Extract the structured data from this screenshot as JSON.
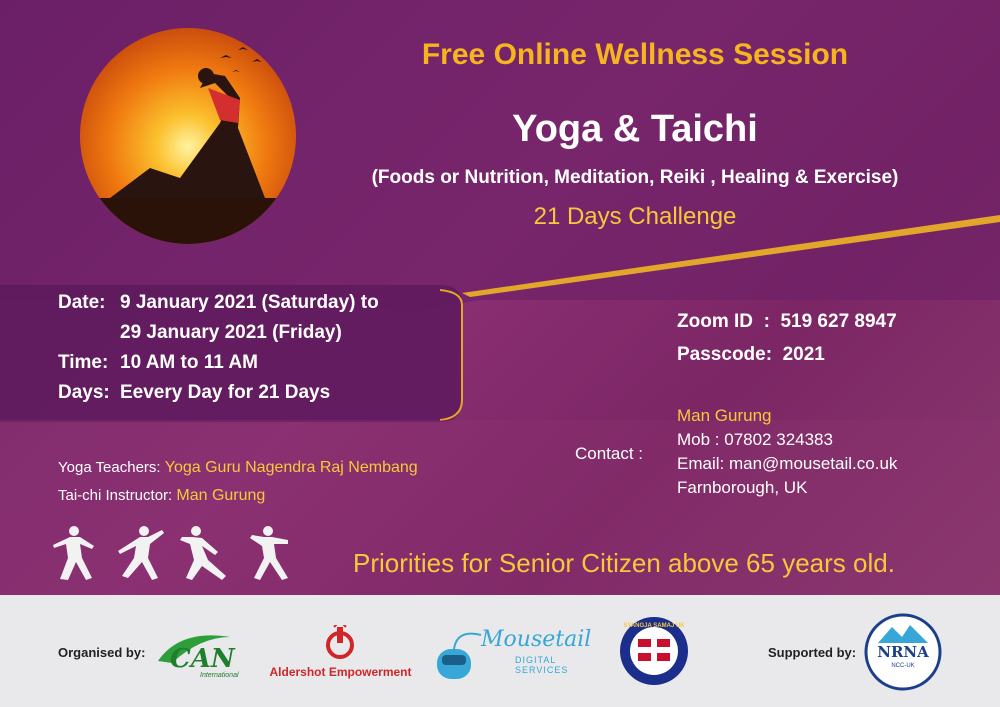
{
  "header": {
    "title": "Free Online Wellness Session",
    "subtitle": "Yoga & Taichi",
    "topics": "(Foods or Nutrition, Meditation, Reiki , Healing & Exercise)",
    "challenge": "21 Days Challenge"
  },
  "schedule": {
    "date_label": "Date:",
    "date_line1": "9 January 2021 (Saturday) to",
    "date_line2": "29 January 2021 (Friday)",
    "time_label": "Time:",
    "time_value": "10 AM to 11 AM",
    "days_label": "Days:",
    "days_value": "Eevery Day for 21 Days"
  },
  "zoom": {
    "id_label": "Zoom ID",
    "id_sep": ":",
    "id_value": "519 627 8947",
    "pass_label": "Passcode:",
    "pass_value": "2021"
  },
  "contact": {
    "label": "Contact :",
    "name": "Man Gurung",
    "mob": "Mob : 07802 324383",
    "email": "Email: man@mousetail.co.uk",
    "location": "Farnborough, UK"
  },
  "teachers": {
    "yoga_label": "Yoga Teachers:",
    "yoga_name": "Yoga Guru Nagendra Raj Nembang",
    "taichi_label": "Tai-chi Instructor:",
    "taichi_name": "Man Gurung"
  },
  "priority": "Priorities for Senior Citizen above 65 years old.",
  "footer": {
    "organised_label": "Organised by:",
    "supported_label": "Supported by:",
    "can_logo_text": "CAN",
    "can_logo_sub": "International",
    "aldershot_text": "Aldershot Empowerment",
    "mousetail_text": "Mousetail",
    "mousetail_sub": "DIGITAL SERVICES",
    "samaj_text": "SYANGJA SAMAJ UK",
    "nrna_text": "NRNA",
    "nrna_sub": "NCC-UK"
  },
  "colors": {
    "accent": "#f6b51e",
    "highlight": "#f6c93a",
    "background": "#7a2a6a",
    "footer": "#e9e9eb"
  }
}
